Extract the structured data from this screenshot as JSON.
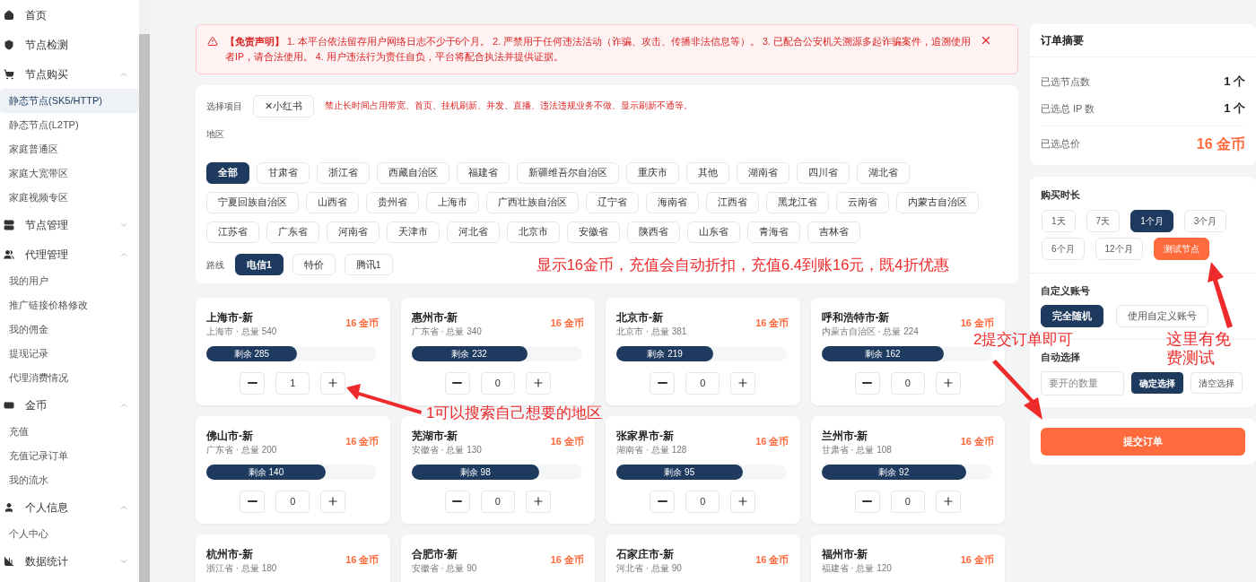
{
  "sidebar": {
    "items": [
      {
        "label": "首页"
      },
      {
        "label": "节点检测"
      },
      {
        "label": "节点购买",
        "expanded": true,
        "children": [
          {
            "label": "静态节点(SK5/HTTP)",
            "selected": true
          },
          {
            "label": "静态节点(L2TP)",
            "selected": false
          },
          {
            "label": "家庭普通区",
            "selected": false
          },
          {
            "label": "家庭大宽带区",
            "selected": false
          },
          {
            "label": "家庭视频专区",
            "selected": false
          }
        ]
      },
      {
        "label": "节点管理",
        "expanded": false
      },
      {
        "label": "代理管理",
        "expanded": true,
        "children": [
          {
            "label": "我的用户",
            "selected": false
          },
          {
            "label": "推广链接价格修改",
            "selected": false
          },
          {
            "label": "我的佣金",
            "selected": false
          },
          {
            "label": "提现记录",
            "selected": false
          },
          {
            "label": "代理消费情况",
            "selected": false
          }
        ]
      },
      {
        "label": "金币",
        "expanded": true,
        "children": [
          {
            "label": "充值",
            "selected": false
          },
          {
            "label": "充值记录订单",
            "selected": false
          },
          {
            "label": "我的流水",
            "selected": false
          }
        ]
      },
      {
        "label": "个人信息",
        "expanded": true,
        "children": [
          {
            "label": "个人中心",
            "selected": false
          }
        ]
      },
      {
        "label": "数据统计",
        "expanded": false
      }
    ]
  },
  "disclaimer": "**【免责声明】** 1. 本平台依法留存用户网络日志不少于6个月。 2. 严禁用于任何违法活动（诈骗、攻击、传播非法信息等）。 3. 已配合公安机关溯源多起诈骗案件，追溯使用者IP，请合法使用。 4. 用户违法行为责任自负，平台将配合执法并提供证据。",
  "filters": {
    "project_label": "选择项目",
    "project_tag": "✕小红书",
    "project_note": "禁止长时间占用带宽、首页、挂机刷新、并发、直播、违法违规业务不做、显示刷新不通等。",
    "region_label": "地区",
    "regions": [
      {
        "label": "全部",
        "selected": true
      },
      {
        "label": "甘肃省",
        "selected": false
      },
      {
        "label": "浙江省",
        "selected": false
      },
      {
        "label": "西藏自治区",
        "selected": false
      },
      {
        "label": "福建省",
        "selected": false
      },
      {
        "label": "新疆维吾尔自治区",
        "selected": false
      },
      {
        "label": "重庆市",
        "selected": false
      },
      {
        "label": "其他",
        "selected": false
      },
      {
        "label": "湖南省",
        "selected": false
      },
      {
        "label": "四川省",
        "selected": false
      },
      {
        "label": "湖北省",
        "selected": false
      },
      {
        "label": "宁夏回族自治区",
        "selected": false
      },
      {
        "label": "山西省",
        "selected": false
      },
      {
        "label": "贵州省",
        "selected": false
      },
      {
        "label": "上海市",
        "selected": false
      },
      {
        "label": "广西壮族自治区",
        "selected": false
      },
      {
        "label": "辽宁省",
        "selected": false
      },
      {
        "label": "海南省",
        "selected": false
      },
      {
        "label": "江西省",
        "selected": false
      },
      {
        "label": "黑龙江省",
        "selected": false
      },
      {
        "label": "云南省",
        "selected": false
      },
      {
        "label": "内蒙古自治区",
        "selected": false
      },
      {
        "label": "江苏省",
        "selected": false
      },
      {
        "label": "广东省",
        "selected": false
      },
      {
        "label": "河南省",
        "selected": false
      },
      {
        "label": "天津市",
        "selected": false
      },
      {
        "label": "河北省",
        "selected": false
      },
      {
        "label": "北京市",
        "selected": false
      },
      {
        "label": "安徽省",
        "selected": false
      },
      {
        "label": "陕西省",
        "selected": false
      },
      {
        "label": "山东省",
        "selected": false
      },
      {
        "label": "青海省",
        "selected": false
      },
      {
        "label": "吉林省",
        "selected": false
      }
    ],
    "route_label": "路线",
    "routes": [
      {
        "label": "电信1",
        "selected": true
      },
      {
        "label": "特价",
        "selected": false
      },
      {
        "label": "腾讯1",
        "selected": false
      }
    ]
  },
  "annotations": [
    "显示16金币，充值会自动折扣，充值6.4到账16元，既4折优惠",
    "1可以搜索自己想要的地区",
    "2提交订单即可",
    "这里有免费测试"
  ],
  "nodes": [
    {
      "title": "上海市-新",
      "subtitle": "上海市 · 总量 540",
      "price": "16 金币",
      "remaining": "剩余 285",
      "level": 0.53,
      "quantity": "1"
    },
    {
      "title": "惠州市-新",
      "subtitle": "广东省 · 总量 340",
      "price": "16 金币",
      "remaining": "剩余 232",
      "level": 0.68,
      "quantity": "0"
    },
    {
      "title": "北京市-新",
      "subtitle": "北京市 · 总量 381",
      "price": "16 金币",
      "remaining": "剩余 219",
      "level": 0.57,
      "quantity": "0"
    },
    {
      "title": "呼和浩特市-新",
      "subtitle": "内蒙古自治区 · 总量 224",
      "price": "16 金币",
      "remaining": "剩余 162",
      "level": 0.72,
      "quantity": "0"
    },
    {
      "title": "佛山市-新",
      "subtitle": "广东省 · 总量 200",
      "price": "16 金币",
      "remaining": "剩余 140",
      "level": 0.7,
      "quantity": "0"
    },
    {
      "title": "芜湖市-新",
      "subtitle": "安徽省 · 总量 130",
      "price": "16 金币",
      "remaining": "剩余 98",
      "level": 0.75,
      "quantity": "0"
    },
    {
      "title": "张家界市-新",
      "subtitle": "湖南省 · 总量 128",
      "price": "16 金币",
      "remaining": "剩余 95",
      "level": 0.74,
      "quantity": "0"
    },
    {
      "title": "兰州市-新",
      "subtitle": "甘肃省 · 总量 108",
      "price": "16 金币",
      "remaining": "剩余 92",
      "level": 0.85,
      "quantity": "0"
    },
    {
      "title": "杭州市-新",
      "subtitle": "浙江省 · 总量 180",
      "price": "16 金币"
    },
    {
      "title": "合肥市-新",
      "subtitle": "安徽省 · 总量 90",
      "price": "16 金币"
    },
    {
      "title": "石家庄市-新",
      "subtitle": "河北省 · 总量 90",
      "price": "16 金币"
    },
    {
      "title": "福州市-新",
      "subtitle": "福建省 · 总量 120",
      "price": "16 金币"
    }
  ],
  "summary": {
    "title": "订单摘要",
    "rows": [
      {
        "label": "已选节点数",
        "value": "1 个",
        "kind": "count"
      },
      {
        "label": "已选总 IP 数",
        "value": "1 个",
        "kind": "count"
      },
      {
        "label": "已选总价",
        "value": "16 金币",
        "kind": "total"
      }
    ]
  },
  "duration": {
    "label": "购买时长",
    "options": [
      {
        "label": "1天",
        "selected": false,
        "kind": "period"
      },
      {
        "label": "7天",
        "selected": false,
        "kind": "period"
      },
      {
        "label": "1个月",
        "selected": true,
        "kind": "period"
      },
      {
        "label": "3个月",
        "selected": false,
        "kind": "period"
      },
      {
        "label": "6个月",
        "selected": false,
        "kind": "period"
      },
      {
        "label": "12个月",
        "selected": false,
        "kind": "period"
      },
      {
        "label": "测试节点",
        "selected": false,
        "kind": "trial"
      }
    ]
  },
  "account": {
    "label": "自定义账号",
    "options": [
      {
        "label": "完全随机",
        "selected": true
      },
      {
        "label": "使用自定义账号",
        "selected": false
      }
    ]
  },
  "auto_select": {
    "label": "自动选择",
    "placeholder": "要开的数量",
    "buttons": [
      {
        "label": "确定选择",
        "kind": "primary"
      },
      {
        "label": "清空选择",
        "kind": "secondary"
      }
    ]
  },
  "submit": "提交订单"
}
